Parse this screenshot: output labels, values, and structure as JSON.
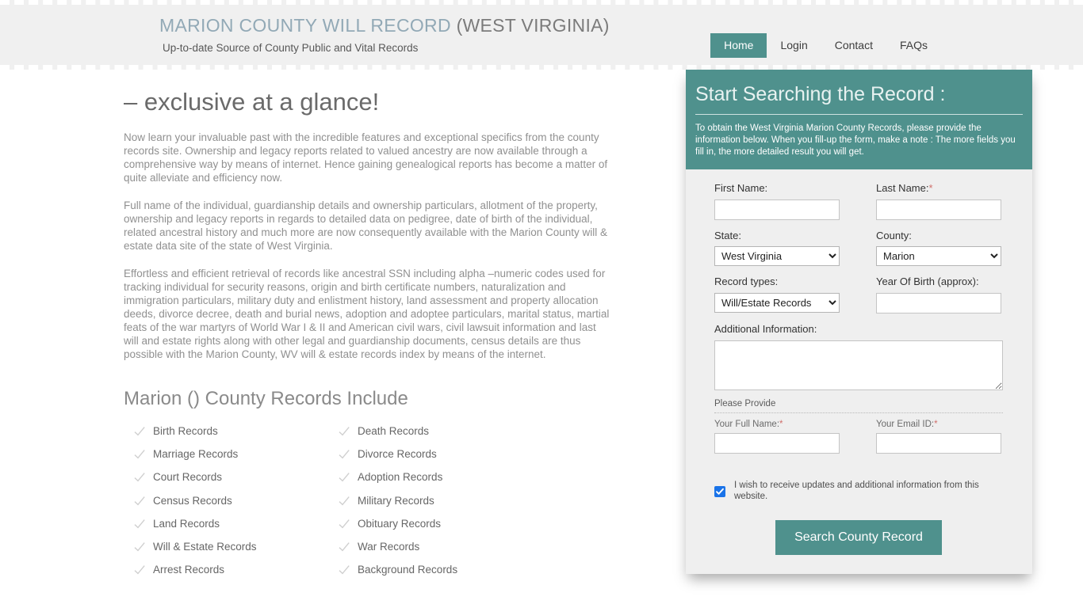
{
  "header": {
    "brand_title_main": "MARION COUNTY WILL RECORD ",
    "brand_title_state": "(WEST VIRGINIA)",
    "brand_subtitle": "Up-to-date Source of  County Public and Vital Records",
    "nav": [
      {
        "label": "Home",
        "active": true
      },
      {
        "label": "Login",
        "active": false
      },
      {
        "label": "Contact",
        "active": false
      },
      {
        "label": "FAQs",
        "active": false
      }
    ]
  },
  "main": {
    "page_title": "– exclusive at a glance!",
    "paragraphs": [
      "Now learn your invaluable past with the incredible features and exceptional specifics from the county records site. Ownership and legacy reports related to valued ancestry are now available through a comprehensive way by means of internet. Hence gaining genealogical reports has become a matter of quite alleviate and efficiency now.",
      "Full name of the individual, guardianship details and ownership particulars, allotment of the property, ownership and legacy reports in regards to detailed data on pedigree, date of birth of the individual, related ancestral history and much more are now consequently available with the Marion County will & estate data site of the state of West Virginia.",
      "Effortless and efficient retrieval of records like ancestral SSN including alpha –numeric codes used for tracking individual for security reasons, origin and birth certificate numbers, naturalization and immigration particulars, military duty and enlistment history, land assessment and property allocation deeds, divorce decree, death and burial news, adoption and adoptee particulars, marital status, martial feats of the war martyrs of World War I & II and American civil wars, civil lawsuit information and last will and estate rights along with other legal and guardianship documents, census details are thus possible with the Marion County, WV will & estate records index by means of the internet."
    ],
    "records_section_title": "Marion () County Records Include",
    "records": [
      "Birth Records",
      "Death Records",
      "Marriage Records",
      "Divorce Records",
      "Court Records",
      "Adoption Records",
      "Census Records",
      "Military Records",
      "Land Records",
      "Obituary Records",
      "Will & Estate Records",
      "War Records",
      "Arrest Records",
      "Background Records"
    ]
  },
  "form": {
    "heading": "Start Searching the Record :",
    "intro": "To obtain the West Virginia Marion County Records, please provide the information below. When you fill-up the form, make a note : The more fields you fill in, the more detailed result you will get.",
    "first_name": {
      "label": "First Name:",
      "value": "",
      "required": false
    },
    "last_name": {
      "label": "Last Name:",
      "value": "",
      "required": true,
      "required_mark": "*"
    },
    "state": {
      "label": "State:",
      "selected": "West Virginia",
      "options": [
        "West Virginia"
      ]
    },
    "county": {
      "label": "County:",
      "selected": "Marion",
      "options": [
        "Marion"
      ]
    },
    "record_types": {
      "label": "Record types:",
      "selected": "Will/Estate Records",
      "options": [
        "Will/Estate Records"
      ]
    },
    "year_of_birth": {
      "label": "Year Of Birth (approx):",
      "value": ""
    },
    "additional_info": {
      "label": "Additional Information:",
      "value": ""
    },
    "please_provide": "Please Provide",
    "full_name": {
      "label": "Your Full Name:",
      "value": "",
      "required_mark": "*"
    },
    "email": {
      "label": "Your Email ID:",
      "value": "",
      "required_mark": "*"
    },
    "consent": {
      "label": "I wish to receive updates and additional information from this website.",
      "checked": true
    },
    "submit_label": "Search County Record"
  },
  "colors": {
    "accent_teal": "#4f918d",
    "panel_bg": "#efefef",
    "header_bg": "#f0f0f0",
    "brand_blue": "#92a9b6",
    "required_red": "#d0706c",
    "checkbox_blue": "#1a73e8"
  }
}
